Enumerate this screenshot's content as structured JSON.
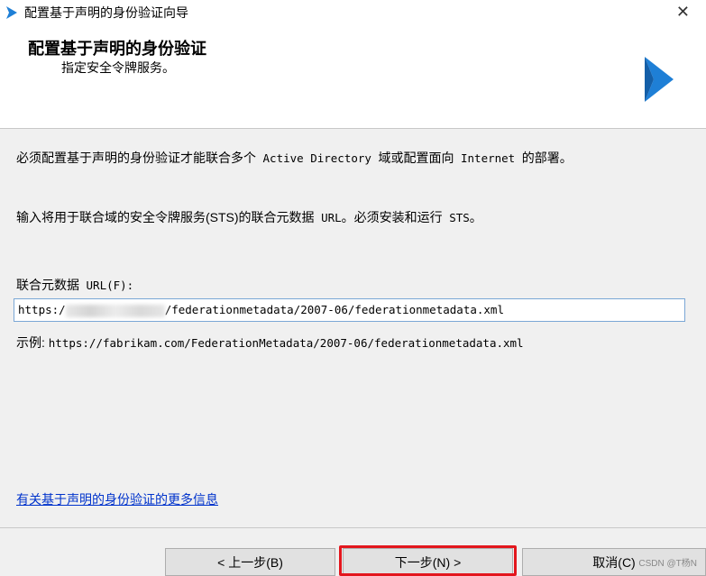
{
  "window": {
    "title": "配置基于声明的身份验证向导",
    "close_glyph": "✕"
  },
  "header": {
    "title": "配置基于声明的身份验证",
    "subtitle": "指定安全令牌服务。"
  },
  "body": {
    "paragraph1_cn": "必须配置基于声明的身份验证才能联合多个",
    "paragraph1_en1": " Active Directory ",
    "paragraph1_cn2": "域或配置面向",
    "paragraph1_en2": " Internet ",
    "paragraph1_cn3": "的部署。",
    "paragraph2_cn": "输入将用于联合域的安全令牌服务(STS)的联合元数据",
    "paragraph2_en": " URL",
    "paragraph2_cn2": "。必须安装和运行",
    "paragraph2_en2": " STS",
    "paragraph2_cn3": "。",
    "field_label_cn": "联合元数据",
    "field_label_en": " URL(F):",
    "url_prefix": "https:/",
    "url_suffix": "/federationmetadata/2007-06/federationmetadata.xml",
    "example_cn": "示例: ",
    "example_url": "https://fabrikam.com/FederationMetadata/2007-06/federationmetadata.xml",
    "more_info_link": "有关基于声明的身份验证的更多信息"
  },
  "buttons": {
    "back": "< 上一步(B)",
    "next": "下一步(N) >",
    "cancel": "取消(C)"
  },
  "watermark": "CSDN @T杨N",
  "colors": {
    "highlight": "#e3161d",
    "link": "#0033cc",
    "logo": "#1e7fd6"
  }
}
